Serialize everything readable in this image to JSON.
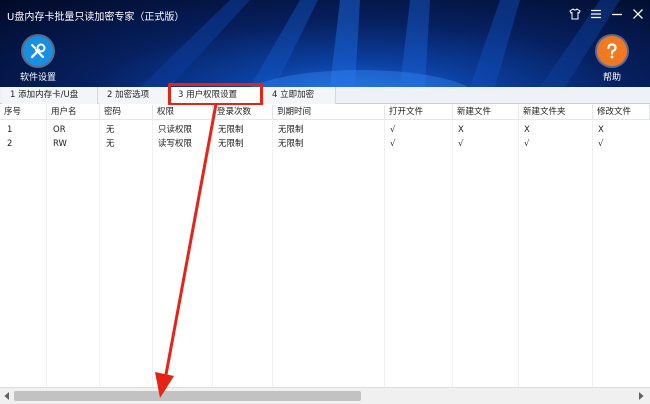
{
  "window": {
    "title": "U盘内存卡批量只读加密专家（正式版）",
    "controls": [
      "shirt-icon",
      "menu-icon",
      "minimize-icon",
      "close-icon"
    ]
  },
  "toolbar": {
    "settings_label": "软件设置",
    "help_label": "帮助",
    "settings_color": "#1a8fe0",
    "help_color": "#f07a22"
  },
  "tabs": [
    {
      "label": "1 添加内存卡/U盘",
      "active": false
    },
    {
      "label": "2 加密选项",
      "active": false
    },
    {
      "label": "3 用户权限设置",
      "active": true
    },
    {
      "label": "4 立即加密",
      "active": false
    }
  ],
  "table": {
    "columns": [
      "序号",
      "用户名",
      "密码",
      "权限",
      "登录次数",
      "到期时间",
      "打开文件",
      "新建文件",
      "新建文件夹",
      "修改文件"
    ],
    "rows": [
      [
        "1",
        "OR",
        "无",
        "只读权限",
        "无限制",
        "无限制",
        "√",
        "X",
        "X",
        "X"
      ],
      [
        "2",
        "RW",
        "无",
        "读写权限",
        "无限制",
        "无限制",
        "√",
        "√",
        "√",
        "√"
      ]
    ]
  },
  "colors": {
    "annotation": "#e52418",
    "header_dark": "#020a26",
    "header_blue": "#1a6fd6"
  }
}
